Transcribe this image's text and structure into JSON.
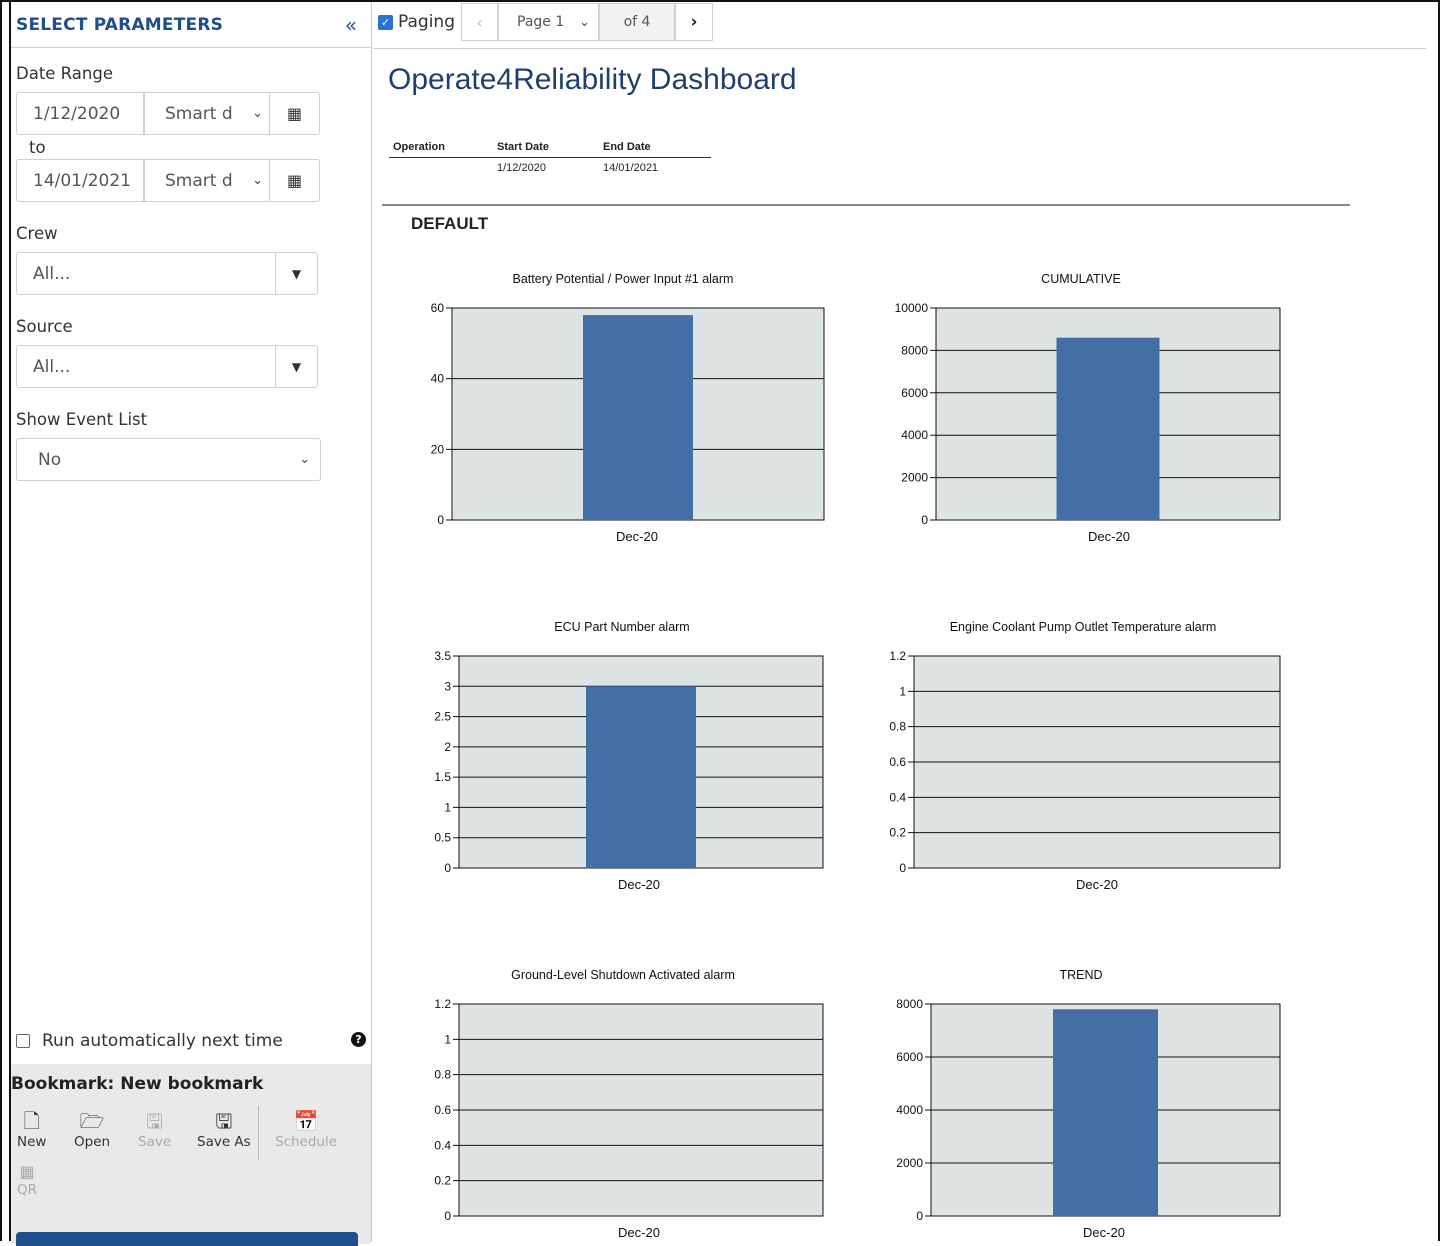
{
  "sidebar": {
    "title": "SELECT PARAMETERS",
    "date_range_label": "Date Range",
    "start_date": "1/12/2020",
    "start_smart": "Smart d",
    "to_label": "to",
    "end_date": "14/01/2021",
    "end_smart": "Smart d",
    "crew_label": "Crew",
    "crew_value": "All...",
    "source_label": "Source",
    "source_value": "All...",
    "show_event_label": "Show Event List",
    "show_event_value": "No",
    "auto_run_label": "Run automatically next time",
    "bookmark_title": "Bookmark: New bookmark",
    "bookmark_buttons": {
      "new": "New",
      "open": "Open",
      "save": "Save",
      "save_as": "Save As",
      "schedule": "Schedule",
      "qr": "QR"
    }
  },
  "toolbar": {
    "paging_label": "Paging",
    "page_value": "Page 1",
    "page_of": "of 4"
  },
  "report": {
    "title": "Operate4Reliability Dashboard",
    "param_table": {
      "headers": [
        "Operation",
        "Start Date",
        "End Date"
      ],
      "row": [
        "",
        "1/12/2020",
        "14/01/2021"
      ]
    },
    "section": "DEFAULT"
  },
  "colors": {
    "bar": "#436fa6",
    "plot_bg": "#dee4e4",
    "title": "#1f3f6e",
    "accent": "#1f4e8c"
  },
  "chart_data": [
    {
      "type": "bar",
      "title": "Battery Potential / Power Input #1 alarm",
      "categories": [
        "Dec-20"
      ],
      "values": [
        58
      ],
      "ylim": [
        0,
        60
      ],
      "yticks": [
        0,
        20,
        40,
        60
      ]
    },
    {
      "type": "bar",
      "title": "CUMULATIVE",
      "categories": [
        "Dec-20"
      ],
      "values": [
        8600
      ],
      "ylim": [
        0,
        10000
      ],
      "yticks": [
        0,
        2000,
        4000,
        6000,
        8000,
        10000
      ]
    },
    {
      "type": "bar",
      "title": "ECU Part Number alarm",
      "categories": [
        "Dec-20"
      ],
      "values": [
        3
      ],
      "ylim": [
        0,
        3.5
      ],
      "yticks": [
        0,
        0.5,
        1,
        1.5,
        2,
        2.5,
        3,
        3.5
      ]
    },
    {
      "type": "bar",
      "title": "Engine Coolant Pump Outlet Temperature alarm",
      "categories": [
        "Dec-20"
      ],
      "values": [
        0
      ],
      "ylim": [
        0,
        1.2
      ],
      "yticks": [
        0,
        0.2,
        0.4,
        0.6,
        0.8,
        1,
        1.2
      ]
    },
    {
      "type": "bar",
      "title": "Ground-Level Shutdown Activated alarm",
      "categories": [
        "Dec-20"
      ],
      "values": [
        0
      ],
      "ylim": [
        0,
        1.2
      ],
      "yticks": [
        0,
        0.2,
        0.4,
        0.6,
        0.8,
        1,
        1.2
      ]
    },
    {
      "type": "bar",
      "title": "TREND",
      "categories": [
        "Dec-20"
      ],
      "values": [
        7800
      ],
      "ylim": [
        0,
        8000
      ],
      "yticks": [
        0,
        2000,
        4000,
        6000,
        8000
      ]
    }
  ]
}
